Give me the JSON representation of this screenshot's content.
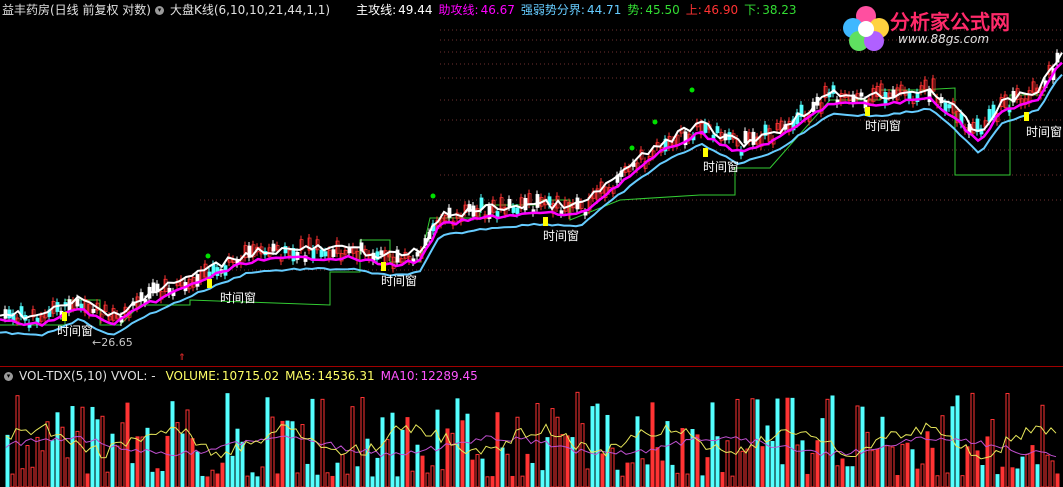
{
  "price_header": {
    "title": "益丰药房(日线 前复权 对数)",
    "indicator": "大盘K线(6,10,10,21,44,1,1)",
    "zhugong_label": "主攻线:",
    "zhugong_value": "49.44",
    "zhugong2_label": "助攻线:",
    "zhugong2_value": "46.67",
    "qiangruo_label": "强弱势分界:",
    "qiangruo_value": "44.71",
    "shi_label": "势:",
    "shi_value": "45.50",
    "shang_label": "上:",
    "shang_value": "46.90",
    "xia_label": "下:",
    "xia_value": "38.23"
  },
  "volume_header": {
    "indicator": "VOL-TDX(5,10)",
    "vvol": "VVOL: -",
    "volume_label": "VOLUME:",
    "volume_value": "10715.02",
    "ma5_label": "MA5:",
    "ma5_value": "14536.31",
    "ma10_label": "MA10:",
    "ma10_value": "12289.45"
  },
  "logo": {
    "title": "分析家公式网",
    "url": "www.88gs.com"
  },
  "annotations": {
    "time_window": "时间窗",
    "low_marker": "←26.65"
  },
  "colors": {
    "background": "#000000",
    "divider": "#a00000",
    "zhugong": "#ffffff",
    "zhugong2": "#ff00ff",
    "qiangruo": "#66ccff",
    "channel": "#33cc33",
    "up_candle": "#ff3333",
    "down_candle": "#54ffff",
    "ma5": "#e6e65a",
    "ma10": "#c050d0",
    "signal_dot": "#00e000",
    "time_window_marker": "#ffff00"
  },
  "chart_data": {
    "type": "line",
    "series": [
      {
        "name": "主攻线",
        "last_value": 49.44
      },
      {
        "name": "助攻线",
        "last_value": 46.67
      },
      {
        "name": "强弱势分界",
        "last_value": 44.71
      },
      {
        "name": "势",
        "last_value": 45.5
      },
      {
        "name": "上",
        "last_value": 46.9
      },
      {
        "name": "下",
        "last_value": 38.23
      }
    ],
    "volume": {
      "last": 10715.02,
      "ma5": 14536.31,
      "ma10": 12289.45
    },
    "period_low": 26.65
  }
}
